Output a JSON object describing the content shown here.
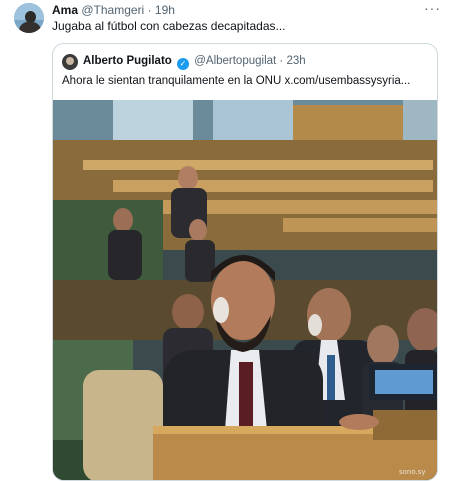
{
  "tweet": {
    "author_name": "Ama",
    "author_handle": "@Thamgeri",
    "separator": "·",
    "time": "19h",
    "more_icon": "more-icon",
    "text": "Jugaba al fútbol con cabezas decapitadas..."
  },
  "quoted_tweet": {
    "author_name": "Alberto Pugilato",
    "verified_icon": "verified-badge-icon",
    "author_handle": "@Albertopugilat",
    "separator": "·",
    "time": "23h",
    "text": "Ahora le sientan tranquilamente en la ONU  x.com/usembassysyria...",
    "photo_watermark": "sono.sy"
  },
  "colors": {
    "muted": "#536471",
    "border": "#cfd9de",
    "verified": "#1d9bf0"
  }
}
